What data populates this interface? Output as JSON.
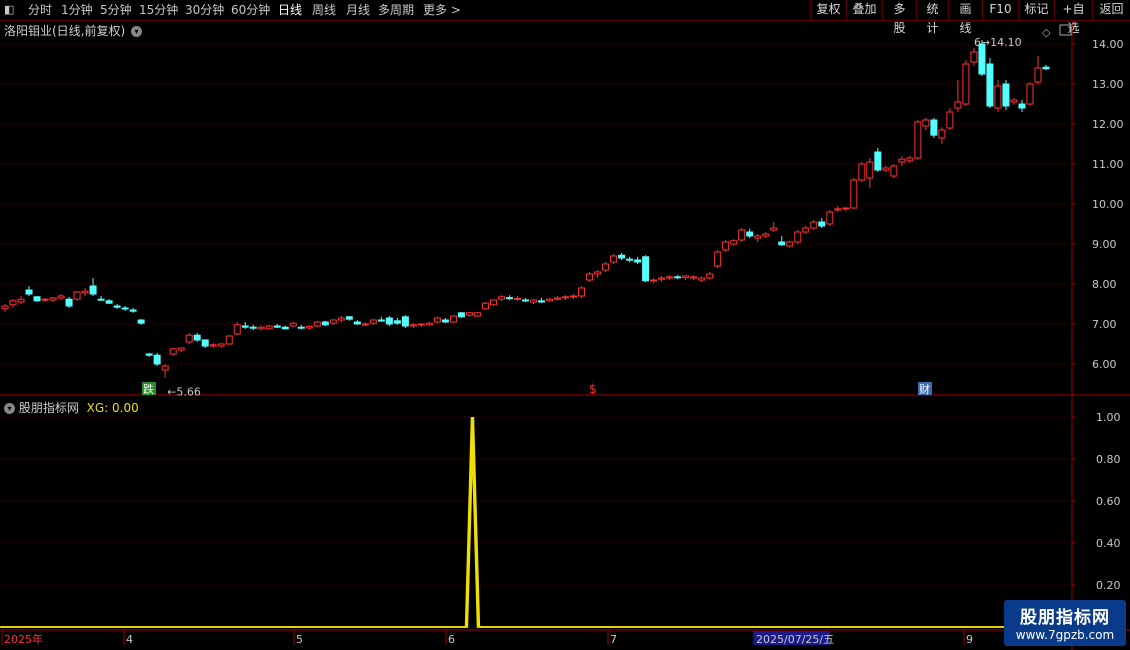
{
  "toolbar": {
    "periods": [
      "分时",
      "1分钟",
      "5分钟",
      "15分钟",
      "30分钟",
      "60分钟",
      "日线",
      "周线",
      "月线",
      "多周期",
      "更多 >"
    ],
    "active_period": "日线",
    "buttons": [
      "复权",
      "叠加",
      "多股",
      "统计",
      "画线",
      "F10",
      "标记",
      "+自选",
      "返回"
    ]
  },
  "stock": {
    "title": "洛阳钼业(日线,前复权)"
  },
  "main_chart": {
    "y_ticks": [
      "14.00",
      "13.00",
      "12.00",
      "11.00",
      "10.00",
      "9.00",
      "8.00",
      "7.00",
      "6.00"
    ],
    "low_label": "5.66",
    "high_label": "14.10",
    "markers": [
      {
        "text": "跌",
        "color": "#2a8a2a"
      },
      {
        "text": "$",
        "color": "#ff3030"
      },
      {
        "text": "财",
        "color": "#3a6ab0"
      }
    ]
  },
  "indicator": {
    "name": "股朋指标网",
    "xg_label": "XG: 0.00",
    "y_ticks": [
      "1.00",
      "0.80",
      "0.60",
      "0.40",
      "0.20"
    ],
    "peak_value": 1.0
  },
  "x_axis": {
    "labels": [
      "2025年",
      "4",
      "5",
      "6",
      "7",
      "2025/07/25/五",
      "9"
    ]
  },
  "colors": {
    "up": "#ff3232",
    "down": "#54ffff",
    "line": "#f0e000",
    "axis": "#a00000"
  },
  "chart_data": {
    "type": "candlestick",
    "title": "洛阳钼业(日线,前复权)",
    "ylim": [
      5.5,
      14.3
    ],
    "candles": [
      [
        7.38,
        7.5,
        7.3,
        7.45
      ],
      [
        7.48,
        7.62,
        7.4,
        7.58
      ],
      [
        7.55,
        7.7,
        7.5,
        7.62
      ],
      [
        7.85,
        7.95,
        7.7,
        7.75
      ],
      [
        7.68,
        7.7,
        7.55,
        7.58
      ],
      [
        7.6,
        7.65,
        7.55,
        7.62
      ],
      [
        7.6,
        7.68,
        7.55,
        7.65
      ],
      [
        7.65,
        7.75,
        7.6,
        7.7
      ],
      [
        7.62,
        7.68,
        7.4,
        7.45
      ],
      [
        7.62,
        7.82,
        7.58,
        7.8
      ],
      [
        7.78,
        7.9,
        7.7,
        7.82
      ],
      [
        7.95,
        8.15,
        7.7,
        7.75
      ],
      [
        7.62,
        7.7,
        7.58,
        7.6
      ],
      [
        7.58,
        7.62,
        7.5,
        7.52
      ],
      [
        7.45,
        7.5,
        7.38,
        7.42
      ],
      [
        7.4,
        7.45,
        7.32,
        7.38
      ],
      [
        7.35,
        7.4,
        7.28,
        7.32
      ],
      [
        7.1,
        7.12,
        6.98,
        7.02
      ],
      [
        6.25,
        6.28,
        6.18,
        6.22
      ],
      [
        6.22,
        6.28,
        5.95,
        6.0
      ],
      [
        5.85,
        6.0,
        5.66,
        5.95
      ],
      [
        6.25,
        6.4,
        6.2,
        6.38
      ],
      [
        6.35,
        6.42,
        6.3,
        6.4
      ],
      [
        6.55,
        6.78,
        6.5,
        6.72
      ],
      [
        6.72,
        6.78,
        6.55,
        6.6
      ],
      [
        6.6,
        6.62,
        6.4,
        6.45
      ],
      [
        6.45,
        6.52,
        6.4,
        6.48
      ],
      [
        6.45,
        6.52,
        6.42,
        6.5
      ],
      [
        6.5,
        6.72,
        6.48,
        6.7
      ],
      [
        6.75,
        7.05,
        6.72,
        6.98
      ],
      [
        6.95,
        7.05,
        6.88,
        6.92
      ],
      [
        6.92,
        6.98,
        6.85,
        6.9
      ],
      [
        6.88,
        6.95,
        6.84,
        6.92
      ],
      [
        6.88,
        6.98,
        6.86,
        6.95
      ],
      [
        6.95,
        7.0,
        6.9,
        6.92
      ],
      [
        6.92,
        6.96,
        6.86,
        6.88
      ],
      [
        6.95,
        7.05,
        6.92,
        7.02
      ],
      [
        6.92,
        6.98,
        6.86,
        6.9
      ],
      [
        6.9,
        6.96,
        6.86,
        6.94
      ],
      [
        6.95,
        7.08,
        6.92,
        7.05
      ],
      [
        7.05,
        7.08,
        6.95,
        6.98
      ],
      [
        7.02,
        7.12,
        6.98,
        7.1
      ],
      [
        7.1,
        7.2,
        7.05,
        7.15
      ],
      [
        7.18,
        7.2,
        7.08,
        7.12
      ],
      [
        7.05,
        7.1,
        6.98,
        7.0
      ],
      [
        7.0,
        7.05,
        6.95,
        7.0
      ],
      [
        7.02,
        7.12,
        6.98,
        7.1
      ],
      [
        7.1,
        7.18,
        7.05,
        7.08
      ],
      [
        7.15,
        7.2,
        6.95,
        7.0
      ],
      [
        7.08,
        7.15,
        6.98,
        7.02
      ],
      [
        7.18,
        7.22,
        6.9,
        6.95
      ],
      [
        6.95,
        7.02,
        6.9,
        6.98
      ],
      [
        6.98,
        7.02,
        6.92,
        7.0
      ],
      [
        6.98,
        7.05,
        6.95,
        7.02
      ],
      [
        7.05,
        7.18,
        7.02,
        7.15
      ],
      [
        7.1,
        7.15,
        7.02,
        7.05
      ],
      [
        7.05,
        7.22,
        7.02,
        7.2
      ],
      [
        7.28,
        7.3,
        7.15,
        7.18
      ],
      [
        7.22,
        7.3,
        7.18,
        7.28
      ],
      [
        7.2,
        7.3,
        7.18,
        7.28
      ],
      [
        7.38,
        7.55,
        7.35,
        7.52
      ],
      [
        7.48,
        7.62,
        7.45,
        7.6
      ],
      [
        7.62,
        7.72,
        7.58,
        7.68
      ],
      [
        7.66,
        7.72,
        7.6,
        7.65
      ],
      [
        7.62,
        7.7,
        7.58,
        7.64
      ],
      [
        7.6,
        7.65,
        7.55,
        7.58
      ],
      [
        7.55,
        7.62,
        7.5,
        7.6
      ],
      [
        7.58,
        7.65,
        7.52,
        7.55
      ],
      [
        7.58,
        7.65,
        7.55,
        7.62
      ],
      [
        7.62,
        7.7,
        7.58,
        7.65
      ],
      [
        7.66,
        7.72,
        7.6,
        7.68
      ],
      [
        7.68,
        7.75,
        7.62,
        7.7
      ],
      [
        7.7,
        7.95,
        7.65,
        7.9
      ],
      [
        8.1,
        8.3,
        8.05,
        8.25
      ],
      [
        8.25,
        8.35,
        8.15,
        8.3
      ],
      [
        8.35,
        8.55,
        8.3,
        8.5
      ],
      [
        8.55,
        8.75,
        8.5,
        8.7
      ],
      [
        8.72,
        8.78,
        8.6,
        8.65
      ],
      [
        8.62,
        8.68,
        8.55,
        8.6
      ],
      [
        8.6,
        8.68,
        8.5,
        8.55
      ],
      [
        8.68,
        8.72,
        8.05,
        8.08
      ],
      [
        8.08,
        8.15,
        8.02,
        8.1
      ],
      [
        8.12,
        8.2,
        8.05,
        8.15
      ],
      [
        8.15,
        8.22,
        8.1,
        8.18
      ],
      [
        8.18,
        8.22,
        8.12,
        8.16
      ],
      [
        8.16,
        8.22,
        8.1,
        8.2
      ],
      [
        8.15,
        8.22,
        8.1,
        8.18
      ],
      [
        8.1,
        8.18,
        8.05,
        8.15
      ],
      [
        8.15,
        8.3,
        8.12,
        8.25
      ],
      [
        8.45,
        8.85,
        8.4,
        8.8
      ],
      [
        8.85,
        9.1,
        8.8,
        9.05
      ],
      [
        9.0,
        9.12,
        8.95,
        9.08
      ],
      [
        9.1,
        9.4,
        9.05,
        9.35
      ],
      [
        9.3,
        9.38,
        9.15,
        9.2
      ],
      [
        9.15,
        9.25,
        9.05,
        9.2
      ],
      [
        9.2,
        9.3,
        9.15,
        9.25
      ],
      [
        9.35,
        9.55,
        9.3,
        9.4
      ],
      [
        9.05,
        9.2,
        8.95,
        8.98
      ],
      [
        8.95,
        9.08,
        8.9,
        9.05
      ],
      [
        9.05,
        9.35,
        9.0,
        9.3
      ],
      [
        9.3,
        9.45,
        9.25,
        9.4
      ],
      [
        9.4,
        9.6,
        9.35,
        9.55
      ],
      [
        9.55,
        9.65,
        9.4,
        9.45
      ],
      [
        9.5,
        9.85,
        9.45,
        9.8
      ],
      [
        9.85,
        9.95,
        9.8,
        9.88
      ],
      [
        9.88,
        9.92,
        9.82,
        9.9
      ],
      [
        9.9,
        10.65,
        9.88,
        10.6
      ],
      [
        10.6,
        11.05,
        10.55,
        11.0
      ],
      [
        10.65,
        11.15,
        10.4,
        11.05
      ],
      [
        11.3,
        11.4,
        10.8,
        10.85
      ],
      [
        10.85,
        10.95,
        10.8,
        10.9
      ],
      [
        10.7,
        11.0,
        10.65,
        10.95
      ],
      [
        11.05,
        11.2,
        10.95,
        11.12
      ],
      [
        11.08,
        11.2,
        11.02,
        11.15
      ],
      [
        11.15,
        12.1,
        11.1,
        12.05
      ],
      [
        11.95,
        12.15,
        11.85,
        12.1
      ],
      [
        12.1,
        12.15,
        11.65,
        11.72
      ],
      [
        11.65,
        11.92,
        11.5,
        11.85
      ],
      [
        11.9,
        12.4,
        11.85,
        12.3
      ],
      [
        12.4,
        13.1,
        12.3,
        12.55
      ],
      [
        12.5,
        13.6,
        12.45,
        13.5
      ],
      [
        13.55,
        13.9,
        13.45,
        13.8
      ],
      [
        14.0,
        14.1,
        13.2,
        13.25
      ],
      [
        13.5,
        13.65,
        12.4,
        12.45
      ],
      [
        12.4,
        13.1,
        12.3,
        12.95
      ],
      [
        13.0,
        13.1,
        12.35,
        12.45
      ],
      [
        12.55,
        12.65,
        12.48,
        12.6
      ],
      [
        12.5,
        12.6,
        12.3,
        12.4
      ],
      [
        12.5,
        13.05,
        12.45,
        13.0
      ],
      [
        13.05,
        13.7,
        12.98,
        13.4
      ],
      [
        13.42,
        13.48,
        13.35,
        13.38
      ]
    ],
    "indicator_series": {
      "name": "XG",
      "peak_index": 59,
      "peak_value": 1.0,
      "ylim": [
        0,
        1.05
      ]
    }
  }
}
